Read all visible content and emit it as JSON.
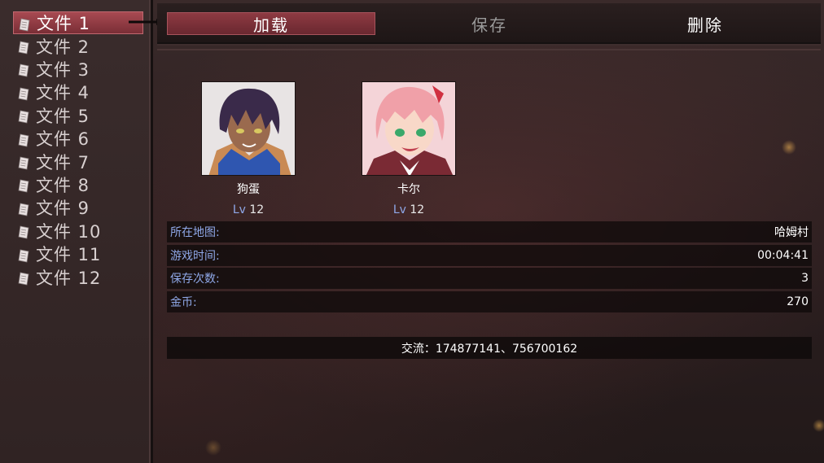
{
  "files": [
    {
      "label": "文件 1",
      "active": true
    },
    {
      "label": "文件 2"
    },
    {
      "label": "文件 3"
    },
    {
      "label": "文件 4"
    },
    {
      "label": "文件 5"
    },
    {
      "label": "文件 6"
    },
    {
      "label": "文件 7"
    },
    {
      "label": "文件 8"
    },
    {
      "label": "文件 9"
    },
    {
      "label": "文件 10"
    },
    {
      "label": "文件 11"
    },
    {
      "label": "文件 12"
    }
  ],
  "tabs": {
    "load": "加载",
    "save": "保存",
    "delete": "删除"
  },
  "characters": [
    {
      "name": "狗蛋",
      "lv_label": "Lv",
      "level": "12",
      "hair_color": "#3a2a4a"
    },
    {
      "name": "卡尔",
      "lv_label": "Lv",
      "level": "12",
      "hair_color": "#f0a0a8"
    }
  ],
  "info": {
    "map": {
      "key": "所在地图:",
      "value": "哈姆村"
    },
    "playtime": {
      "key": "游戏时间:",
      "value": "00:04:41"
    },
    "save_count": {
      "key": "保存次数:",
      "value": "3"
    },
    "gold": {
      "key": "金币:",
      "value": "270"
    }
  },
  "contact": "交流：174877141、756700162",
  "colors": {
    "accent_red": "#8e3a42",
    "key_blue": "#8fa8e8",
    "disabled_gray": "#9a9a9a"
  }
}
